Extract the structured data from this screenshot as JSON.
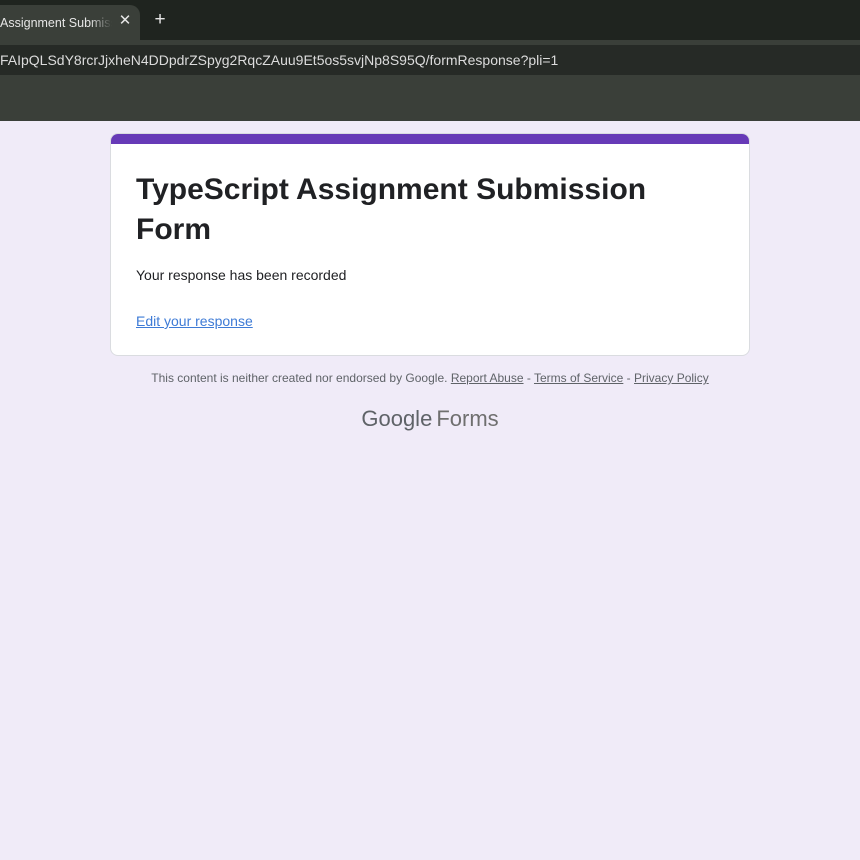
{
  "browser": {
    "tab_title": "Assignment Submission Form",
    "tab_close": "✕",
    "new_tab": "+",
    "url": "FAIpQLSdY8rcrJjxheN4DDpdrZSpyg2RqcZAuu9Et5os5svjNp8S95Q/formResponse?pli=1"
  },
  "form": {
    "title": "TypeScript Assignment Submission Form",
    "confirmation": "Your response has been recorded",
    "edit_link": "Edit your response",
    "accent_color": "#673ab7"
  },
  "footer": {
    "disclaimer": "This content is neither created nor endorsed by Google.",
    "report_abuse": "Report Abuse",
    "sep1": " - ",
    "terms": "Terms of Service",
    "sep2": " - ",
    "privacy": "Privacy Policy",
    "brand_google": "Google",
    "brand_forms": "Forms"
  }
}
